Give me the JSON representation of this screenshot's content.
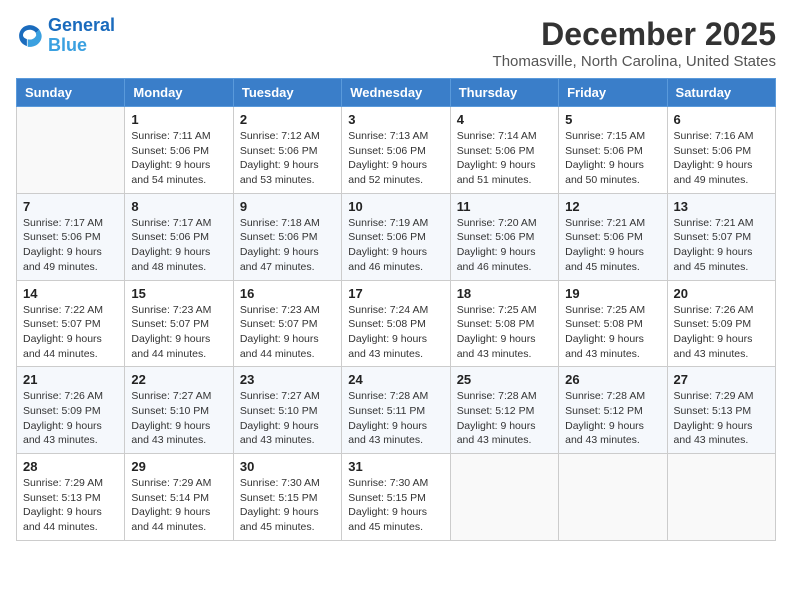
{
  "logo": {
    "line1": "General",
    "line2": "Blue"
  },
  "title": "December 2025",
  "location": "Thomasville, North Carolina, United States",
  "weekdays": [
    "Sunday",
    "Monday",
    "Tuesday",
    "Wednesday",
    "Thursday",
    "Friday",
    "Saturday"
  ],
  "weeks": [
    [
      {
        "day": "",
        "info": ""
      },
      {
        "day": "1",
        "info": "Sunrise: 7:11 AM\nSunset: 5:06 PM\nDaylight: 9 hours\nand 54 minutes."
      },
      {
        "day": "2",
        "info": "Sunrise: 7:12 AM\nSunset: 5:06 PM\nDaylight: 9 hours\nand 53 minutes."
      },
      {
        "day": "3",
        "info": "Sunrise: 7:13 AM\nSunset: 5:06 PM\nDaylight: 9 hours\nand 52 minutes."
      },
      {
        "day": "4",
        "info": "Sunrise: 7:14 AM\nSunset: 5:06 PM\nDaylight: 9 hours\nand 51 minutes."
      },
      {
        "day": "5",
        "info": "Sunrise: 7:15 AM\nSunset: 5:06 PM\nDaylight: 9 hours\nand 50 minutes."
      },
      {
        "day": "6",
        "info": "Sunrise: 7:16 AM\nSunset: 5:06 PM\nDaylight: 9 hours\nand 49 minutes."
      }
    ],
    [
      {
        "day": "7",
        "info": "Sunrise: 7:17 AM\nSunset: 5:06 PM\nDaylight: 9 hours\nand 49 minutes."
      },
      {
        "day": "8",
        "info": "Sunrise: 7:17 AM\nSunset: 5:06 PM\nDaylight: 9 hours\nand 48 minutes."
      },
      {
        "day": "9",
        "info": "Sunrise: 7:18 AM\nSunset: 5:06 PM\nDaylight: 9 hours\nand 47 minutes."
      },
      {
        "day": "10",
        "info": "Sunrise: 7:19 AM\nSunset: 5:06 PM\nDaylight: 9 hours\nand 46 minutes."
      },
      {
        "day": "11",
        "info": "Sunrise: 7:20 AM\nSunset: 5:06 PM\nDaylight: 9 hours\nand 46 minutes."
      },
      {
        "day": "12",
        "info": "Sunrise: 7:21 AM\nSunset: 5:06 PM\nDaylight: 9 hours\nand 45 minutes."
      },
      {
        "day": "13",
        "info": "Sunrise: 7:21 AM\nSunset: 5:07 PM\nDaylight: 9 hours\nand 45 minutes."
      }
    ],
    [
      {
        "day": "14",
        "info": "Sunrise: 7:22 AM\nSunset: 5:07 PM\nDaylight: 9 hours\nand 44 minutes."
      },
      {
        "day": "15",
        "info": "Sunrise: 7:23 AM\nSunset: 5:07 PM\nDaylight: 9 hours\nand 44 minutes."
      },
      {
        "day": "16",
        "info": "Sunrise: 7:23 AM\nSunset: 5:07 PM\nDaylight: 9 hours\nand 44 minutes."
      },
      {
        "day": "17",
        "info": "Sunrise: 7:24 AM\nSunset: 5:08 PM\nDaylight: 9 hours\nand 43 minutes."
      },
      {
        "day": "18",
        "info": "Sunrise: 7:25 AM\nSunset: 5:08 PM\nDaylight: 9 hours\nand 43 minutes."
      },
      {
        "day": "19",
        "info": "Sunrise: 7:25 AM\nSunset: 5:08 PM\nDaylight: 9 hours\nand 43 minutes."
      },
      {
        "day": "20",
        "info": "Sunrise: 7:26 AM\nSunset: 5:09 PM\nDaylight: 9 hours\nand 43 minutes."
      }
    ],
    [
      {
        "day": "21",
        "info": "Sunrise: 7:26 AM\nSunset: 5:09 PM\nDaylight: 9 hours\nand 43 minutes."
      },
      {
        "day": "22",
        "info": "Sunrise: 7:27 AM\nSunset: 5:10 PM\nDaylight: 9 hours\nand 43 minutes."
      },
      {
        "day": "23",
        "info": "Sunrise: 7:27 AM\nSunset: 5:10 PM\nDaylight: 9 hours\nand 43 minutes."
      },
      {
        "day": "24",
        "info": "Sunrise: 7:28 AM\nSunset: 5:11 PM\nDaylight: 9 hours\nand 43 minutes."
      },
      {
        "day": "25",
        "info": "Sunrise: 7:28 AM\nSunset: 5:12 PM\nDaylight: 9 hours\nand 43 minutes."
      },
      {
        "day": "26",
        "info": "Sunrise: 7:28 AM\nSunset: 5:12 PM\nDaylight: 9 hours\nand 43 minutes."
      },
      {
        "day": "27",
        "info": "Sunrise: 7:29 AM\nSunset: 5:13 PM\nDaylight: 9 hours\nand 43 minutes."
      }
    ],
    [
      {
        "day": "28",
        "info": "Sunrise: 7:29 AM\nSunset: 5:13 PM\nDaylight: 9 hours\nand 44 minutes."
      },
      {
        "day": "29",
        "info": "Sunrise: 7:29 AM\nSunset: 5:14 PM\nDaylight: 9 hours\nand 44 minutes."
      },
      {
        "day": "30",
        "info": "Sunrise: 7:30 AM\nSunset: 5:15 PM\nDaylight: 9 hours\nand 45 minutes."
      },
      {
        "day": "31",
        "info": "Sunrise: 7:30 AM\nSunset: 5:15 PM\nDaylight: 9 hours\nand 45 minutes."
      },
      {
        "day": "",
        "info": ""
      },
      {
        "day": "",
        "info": ""
      },
      {
        "day": "",
        "info": ""
      }
    ]
  ]
}
